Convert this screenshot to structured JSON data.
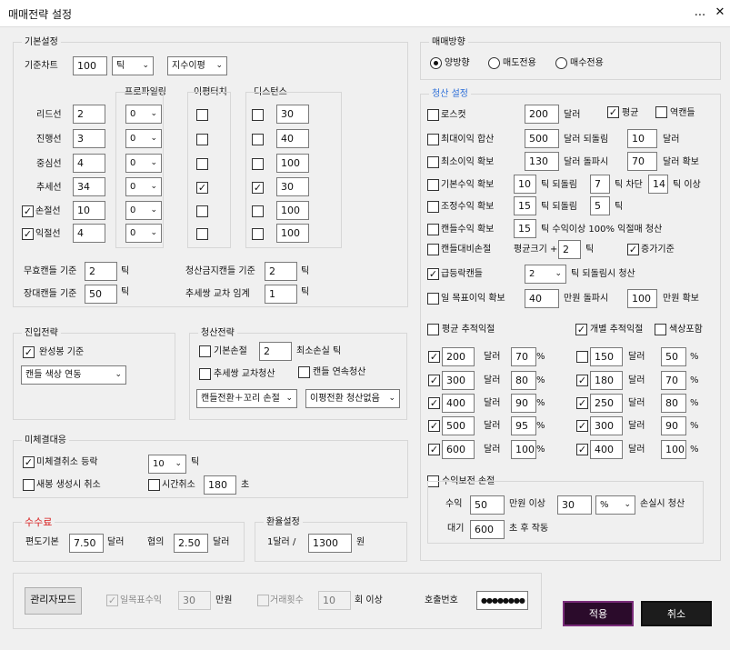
{
  "window": {
    "title": "매매전략 설정",
    "minimize": "...",
    "close": "✕"
  },
  "basic": {
    "title": "기본설정",
    "chart_label": "기준차트",
    "chart_value": "100",
    "chart_unit": "틱",
    "chart_type": "지수이평",
    "header_profiling": "프로파일링",
    "header_ma_touch": "이평터치",
    "header_distance": "디스턴스",
    "rows": [
      {
        "label": "리드선",
        "value": "2",
        "prof": "0",
        "touch": false,
        "dist_checked": false,
        "dist": "30"
      },
      {
        "label": "진행선",
        "value": "3",
        "prof": "0",
        "touch": false,
        "dist_checked": false,
        "dist": "40"
      },
      {
        "label": "중심선",
        "value": "4",
        "prof": "0",
        "touch": false,
        "dist_checked": false,
        "dist": "100"
      },
      {
        "label": "추세선",
        "value": "34",
        "prof": "0",
        "touch": true,
        "dist_checked": true,
        "dist": "30"
      },
      {
        "label": "손절선",
        "value": "10",
        "prof": "0",
        "touch": false,
        "dist_checked": false,
        "dist": "100",
        "checkbox": true,
        "checked": true
      },
      {
        "label": "익절선",
        "value": "4",
        "prof": "0",
        "touch": false,
        "dist_checked": false,
        "dist": "100",
        "checkbox": true,
        "checked": true
      }
    ],
    "no_candle_label": "무효캔들 기준",
    "no_candle_value": "2",
    "no_candle_unit": "틱",
    "long_candle_label": "장대캔들 기준",
    "long_candle_value": "50",
    "long_candle_unit": "틱",
    "liq_ban_label": "청산금지캔들 기준",
    "liq_ban_value": "2",
    "liq_ban_unit": "틱",
    "trend_cross_label": "추세쌍 교차 임계",
    "trend_cross_value": "1",
    "trend_cross_unit": "틱"
  },
  "entry": {
    "title": "진입전략",
    "complete_label": "완성봉 기준",
    "candle_color": "캔들 색상 연동"
  },
  "liquidation": {
    "title": "청산전략",
    "basic_sl_label": "기본손절",
    "basic_sl_value": "2",
    "min_loss_label": "최소손실 틱",
    "trend_cross_label": "추세쌍 교차청산",
    "consecutive_label": "캔들 연속청산",
    "dd1": "캔들전환＋꼬리 손절",
    "dd2": "이평전환 청산없음"
  },
  "pending": {
    "title": "미체결대응",
    "cancel_label": "미체결취소 등락",
    "cancel_value": "10",
    "cancel_unit": "틱",
    "new_cancel_label": "새봉 생성시 취소",
    "time_cancel_label": "시간취소",
    "time_value": "180",
    "time_unit": "초"
  },
  "fee": {
    "title": "수수료",
    "label1": "편도기본",
    "value1": "7.50",
    "unit1": "달러",
    "label2": "협의",
    "value2": "2.50",
    "unit2": "달러",
    "title_color": "#d71b1b"
  },
  "exchange": {
    "title": "환율설정",
    "label": "1달러 /",
    "value": "1300",
    "unit": "원"
  },
  "admin": {
    "button": "관리자모드",
    "daily_target_label": "일목표수익",
    "daily_target_value": "30",
    "daily_target_unit": "만원",
    "trade_count_label": "거래횟수",
    "trade_count_value": "10",
    "trade_count_unit": "회 이상",
    "password_label": "호출번호",
    "password_value": "●●●●●●●●"
  },
  "direction": {
    "title": "매매방향",
    "options": [
      "양방향",
      "매도전용",
      "매수전용"
    ],
    "selected": 0
  },
  "exit": {
    "title": "청산 설정",
    "title_color": "#2e6fd8",
    "losscut_label": "로스컷",
    "losscut_value": "200",
    "losscut_unit": "달러",
    "avg_label": "평균",
    "reverse_label": "역캔들",
    "max_profit_label": "최대이익 합산",
    "max_profit_value": "500",
    "max_profit_unit": "달러 되돌림",
    "max_profit_rb": "10",
    "max_profit_rb_unit": "달러",
    "min_profit_label": "최소이익 확보",
    "min_profit_value": "130",
    "min_profit_unit": "달러 돌파시",
    "min_profit_secure": "70",
    "min_profit_secure_unit": "달러 확보",
    "basic_profit_label": "기본수익 확보",
    "basic_profit_value": "10",
    "basic_profit_unit": "틱 되돌림",
    "basic_profit_rb": "7",
    "basic_profit_cut": "틱  차단",
    "basic_profit_min": "14",
    "basic_profit_min_unit": "틱 이상",
    "adjust_label": "조정수익 확보",
    "adjust_value": "15",
    "adjust_unit": "틱 되돌림",
    "adjust_rb": "5",
    "adjust_rb_unit": "틱",
    "candle_profit_label": "캔들수익 확보",
    "candle_profit_value": "15",
    "candle_profit_text": "틱 수익이상 100% 익절매 청산",
    "candle_compare_label": "캔들대비손절",
    "candle_size_label": "평균크기 +",
    "candle_size_value": "2",
    "candle_size_unit": "틱",
    "increase_label": "증가기준",
    "surge_label": "급등락캔들",
    "surge_value": "2",
    "surge_text": "틱 되돌림시 청산",
    "daily_target_label": "일 목표이익 확보",
    "daily_target_value": "40",
    "daily_target_unit": "만원 돌파시",
    "daily_target_secure": "100",
    "daily_target_secure_unit": "만원 확보",
    "avg_trailing_label": "평균 추적익절",
    "indiv_trailing_label": "개별 추적익절",
    "color_include_label": "색상포함",
    "left_rows": [
      {
        "checked": true,
        "value": "200",
        "unit": "달러",
        "pct": "70",
        "pct_unit": "%"
      },
      {
        "checked": true,
        "value": "300",
        "unit": "달러",
        "pct": "80",
        "pct_unit": "%"
      },
      {
        "checked": true,
        "value": "400",
        "unit": "달러",
        "pct": "90",
        "pct_unit": "%"
      },
      {
        "checked": true,
        "value": "500",
        "unit": "달러",
        "pct": "95",
        "pct_unit": "%"
      },
      {
        "checked": true,
        "value": "600",
        "unit": "달러",
        "pct": "100",
        "pct_unit": "%"
      }
    ],
    "right_rows": [
      {
        "checked": false,
        "value": "150",
        "unit": "달러",
        "pct": "50",
        "pct_unit": "%"
      },
      {
        "checked": true,
        "value": "180",
        "unit": "달러",
        "pct": "70",
        "pct_unit": "%"
      },
      {
        "checked": true,
        "value": "250",
        "unit": "달러",
        "pct": "80",
        "pct_unit": "%"
      },
      {
        "checked": true,
        "value": "300",
        "unit": "달러",
        "pct": "90",
        "pct_unit": "%"
      },
      {
        "checked": true,
        "value": "400",
        "unit": "달러",
        "pct": "100",
        "pct_unit": "%"
      }
    ],
    "breakeven_title": "수익보전 손절",
    "be_profit_label": "수익",
    "be_profit_value": "50",
    "be_profit_unit": "만원 이상",
    "be_loss_value": "30",
    "be_loss_type": "%",
    "be_loss_unit": "손실시 청산",
    "wait_label": "대기",
    "wait_value": "600",
    "wait_unit": "초 후 작동"
  },
  "footer": {
    "apply": "적용",
    "cancel": "취소"
  }
}
